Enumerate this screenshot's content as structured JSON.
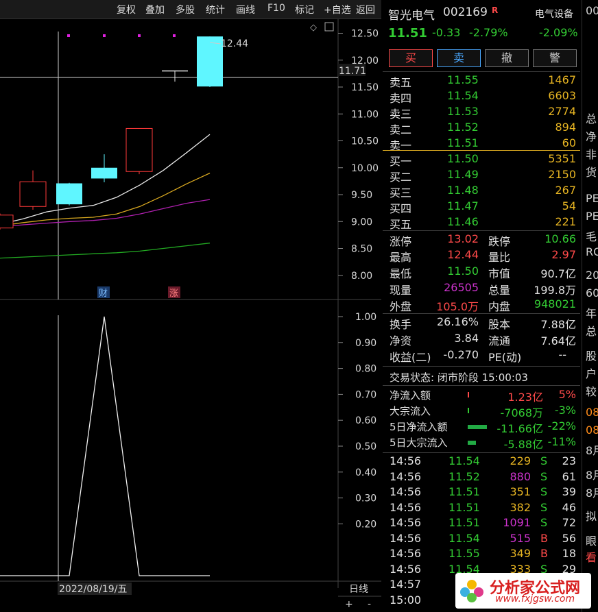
{
  "toolbar": {
    "items": [
      "复权",
      "叠加",
      "多股",
      "统计",
      "画线",
      "F10",
      "标记",
      "+自选",
      "返回"
    ]
  },
  "chart": {
    "price_ticks": [
      "12.50",
      "12.00",
      "11.50",
      "11.00",
      "10.50",
      "10.00",
      "9.50",
      "9.00",
      "8.50",
      "8.00"
    ],
    "cursor_price": "11.71",
    "high_annot": "12.44",
    "tags": [
      "财",
      "涨"
    ],
    "ind_ticks": [
      "1.00",
      "0.90",
      "0.80",
      "0.70",
      "0.60",
      "0.50",
      "0.40",
      "0.30",
      "0.20"
    ],
    "cursor_date": "2022/08/19/五",
    "period": "日线",
    "plus": "+",
    "minus": "-"
  },
  "chart_data": {
    "type": "line",
    "candles": [
      {
        "open": 8.88,
        "close": 9.12,
        "high": 9.15,
        "low": 8.85,
        "color": "red"
      },
      {
        "open": 9.28,
        "close": 9.74,
        "high": 9.95,
        "low": 9.22,
        "color": "red"
      },
      {
        "open": 9.71,
        "close": 9.32,
        "high": 9.72,
        "low": 9.3,
        "color": "cyan"
      },
      {
        "open": 10.0,
        "close": 9.8,
        "high": 10.25,
        "low": 9.73,
        "color": "cyan"
      },
      {
        "open": 9.93,
        "close": 10.73,
        "high": 10.73,
        "low": 9.88,
        "color": "red"
      },
      {
        "open": 11.8,
        "close": 11.8,
        "high": 11.8,
        "low": 11.6,
        "color": "white"
      },
      {
        "open": 12.44,
        "close": 11.51,
        "high": 12.44,
        "low": 11.5,
        "color": "cyan"
      }
    ],
    "ma_lines": [
      {
        "color": "#e8e8e8",
        "values": [
          8.95,
          9.05,
          9.18,
          9.25,
          9.3,
          9.45,
          9.68,
          9.95,
          10.28,
          10.62
        ]
      },
      {
        "color": "#d8a820",
        "values": [
          8.92,
          8.98,
          9.03,
          9.06,
          9.08,
          9.14,
          9.28,
          9.48,
          9.7,
          9.9
        ]
      },
      {
        "color": "#b020b0",
        "values": [
          8.9,
          8.94,
          8.97,
          9.0,
          9.02,
          9.06,
          9.14,
          9.24,
          9.34,
          9.41
        ]
      },
      {
        "color": "#22aa22",
        "values": [
          8.32,
          8.34,
          8.36,
          8.38,
          8.4,
          8.42,
          8.45,
          8.5,
          8.55,
          8.6
        ]
      }
    ],
    "indicator": [
      0,
      0,
      0,
      1.0,
      0,
      0,
      0
    ],
    "ylim": [
      7.8,
      12.6
    ],
    "ind_ylim": [
      0,
      1.0
    ]
  },
  "quote": {
    "name": "智光电气",
    "code": "002169",
    "r_mark": "R",
    "sector": "电气设备",
    "price": "11.51",
    "change": "-0.33",
    "pct": "-2.79%",
    "sector_pct": "-2.09%",
    "buttons": [
      "买",
      "卖",
      "撤",
      "警"
    ]
  },
  "asks": [
    {
      "label": "卖五",
      "price": "11.55",
      "vol": "1467"
    },
    {
      "label": "卖四",
      "price": "11.54",
      "vol": "6603"
    },
    {
      "label": "卖三",
      "price": "11.53",
      "vol": "2774"
    },
    {
      "label": "卖二",
      "price": "11.52",
      "vol": "894"
    },
    {
      "label": "卖一",
      "price": "11.51",
      "vol": "60"
    }
  ],
  "bids": [
    {
      "label": "买一",
      "price": "11.50",
      "vol": "5351"
    },
    {
      "label": "买二",
      "price": "11.49",
      "vol": "2150"
    },
    {
      "label": "买三",
      "price": "11.48",
      "vol": "267"
    },
    {
      "label": "买四",
      "price": "11.47",
      "vol": "54"
    },
    {
      "label": "买五",
      "price": "11.46",
      "vol": "221"
    }
  ],
  "stats": {
    "zt_l": "涨停",
    "zt_v": "13.02",
    "dt_l": "跌停",
    "dt_v": "10.66",
    "zg_l": "最高",
    "zg_v": "12.44",
    "lb_l": "量比",
    "lb_v": "2.97",
    "zd_l": "最低",
    "zd_v": "11.50",
    "sz_l": "市值",
    "sz_v": "90.7亿",
    "xl_l": "现量",
    "xl_v": "26505",
    "zl_l": "总量",
    "zl_v": "199.8万",
    "wp_l": "外盘",
    "wp_v": "105.0万",
    "np_l": "内盘",
    "np_v": "948021",
    "hs_l": "换手",
    "hs_v": "26.16%",
    "gb_l": "股本",
    "gb_v": "7.88亿",
    "jz_l": "净资",
    "jz_v": "3.84",
    "lt_l": "流通",
    "lt_v": "7.64亿",
    "sy_l": "收益(二)",
    "sy_v": "-0.270",
    "pe_l": "PE(动)",
    "pe_v": "--"
  },
  "status": "交易状态: 闭市阶段 15:00:03",
  "flows": [
    {
      "label": "净流入额",
      "value": "1.23亿",
      "pct": "5%",
      "color": "red",
      "bar": 0
    },
    {
      "label": "大宗流入",
      "value": "-7068万",
      "pct": "-3%",
      "color": "green",
      "bar": 0
    },
    {
      "label": "5日净流入额",
      "value": "-11.66亿",
      "pct": "-22%",
      "color": "green",
      "bar": 28
    },
    {
      "label": "5日大宗流入",
      "value": "-5.88亿",
      "pct": "-11%",
      "color": "green",
      "bar": 12
    }
  ],
  "ticks": [
    {
      "time": "14:56",
      "price": "11.54",
      "vol": "229",
      "side": "S",
      "n": "23",
      "vc": "yellow"
    },
    {
      "time": "14:56",
      "price": "11.52",
      "vol": "880",
      "side": "S",
      "n": "61",
      "vc": "purple"
    },
    {
      "time": "14:56",
      "price": "11.51",
      "vol": "351",
      "side": "S",
      "n": "39",
      "vc": "yellow"
    },
    {
      "time": "14:56",
      "price": "11.51",
      "vol": "382",
      "side": "S",
      "n": "46",
      "vc": "yellow"
    },
    {
      "time": "14:56",
      "price": "11.51",
      "vol": "1091",
      "side": "S",
      "n": "72",
      "vc": "purple"
    },
    {
      "time": "14:56",
      "price": "11.54",
      "vol": "515",
      "side": "B",
      "n": "56",
      "vc": "purple"
    },
    {
      "time": "14:56",
      "price": "11.55",
      "vol": "349",
      "side": "B",
      "n": "18",
      "vc": "yellow"
    },
    {
      "time": "14:56",
      "price": "11.54",
      "vol": "333",
      "side": "S",
      "n": "29",
      "vc": "yellow"
    },
    {
      "time": "14:57",
      "price": "",
      "vol": "",
      "side": "",
      "n": "",
      "vc": "yellow"
    },
    {
      "time": "15:00",
      "price": "",
      "vol": "",
      "side": "",
      "n": "",
      "vc": "yellow"
    }
  ],
  "edge": [
    "00",
    "总",
    "净",
    "非",
    "货",
    "PE",
    "PE",
    "毛",
    "RO",
    "20",
    "60",
    "年",
    "总",
    "股",
    "户",
    "较",
    "08",
    "08",
    "8月",
    "8月",
    "8月",
    "拟",
    "眼",
    "看"
  ],
  "watermark": {
    "name": "分析家公式网",
    "url": "www.fxjgsw.com"
  }
}
